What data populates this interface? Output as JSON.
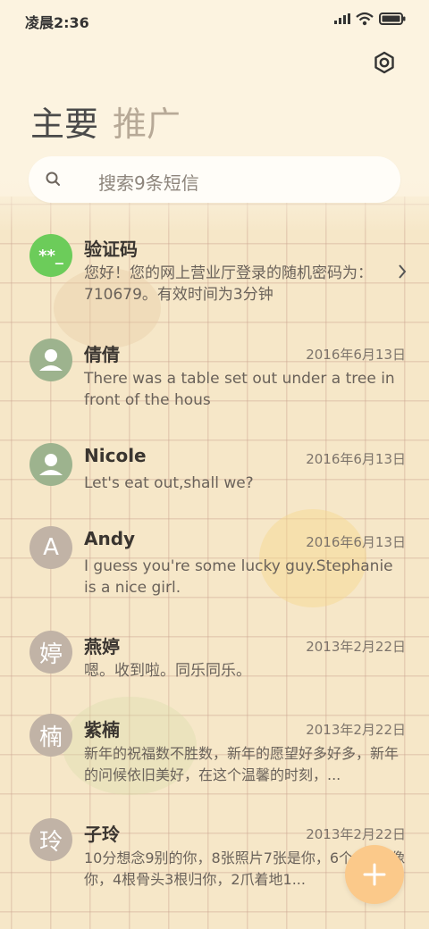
{
  "status_bar": {
    "time": "凌晨2:36"
  },
  "tabs": {
    "main": "主要",
    "promo": "推广"
  },
  "search": {
    "placeholder": "搜索9条短信"
  },
  "conversations": [
    {
      "name": "验证码",
      "avatar": "**_",
      "date": "",
      "preview": "您好！您的网上营业厅登录的随机密码为：710679。有效时间为3分钟"
    },
    {
      "name": "倩倩",
      "avatar": "person-icon",
      "date": "2016年6月13日",
      "preview": "There was a table set out under a tree in front of the hous"
    },
    {
      "name": "Nicole",
      "avatar": "person-icon",
      "date": "2016年6月13日",
      "preview": "Let's eat out,shall we?"
    },
    {
      "name": "Andy",
      "avatar": "A",
      "date": "2016年6月13日",
      "preview": "I guess you're some lucky guy.Stephanie is a nice girl."
    },
    {
      "name": "燕婷",
      "avatar": "婷",
      "date": "2013年2月22日",
      "preview": "嗯。收到啦。同乐同乐。"
    },
    {
      "name": "紫楠",
      "avatar": "楠",
      "date": "2013年2月22日",
      "preview": "新年的祝福数不胜数，新年的愿望好多好多，新年的问候依旧美好，在这个温馨的时刻，..."
    },
    {
      "name": "子玲",
      "avatar": "玲",
      "date": "2013年2月22日",
      "preview": "10分想念9别的你，8张照片7张是你，6个日5只像你，4根骨头3根归你，2爪着地1..."
    }
  ],
  "icons": {
    "settings": "settings-hex-icon",
    "search": "search-icon",
    "fab": "plus-icon",
    "chevron": "chevron-right-icon"
  },
  "colors": {
    "fab": "#fbc98a",
    "code_avatar": "#6ccc5a",
    "person_avatar": "#9db38e",
    "letter_avatar": "#c1b3a6"
  }
}
